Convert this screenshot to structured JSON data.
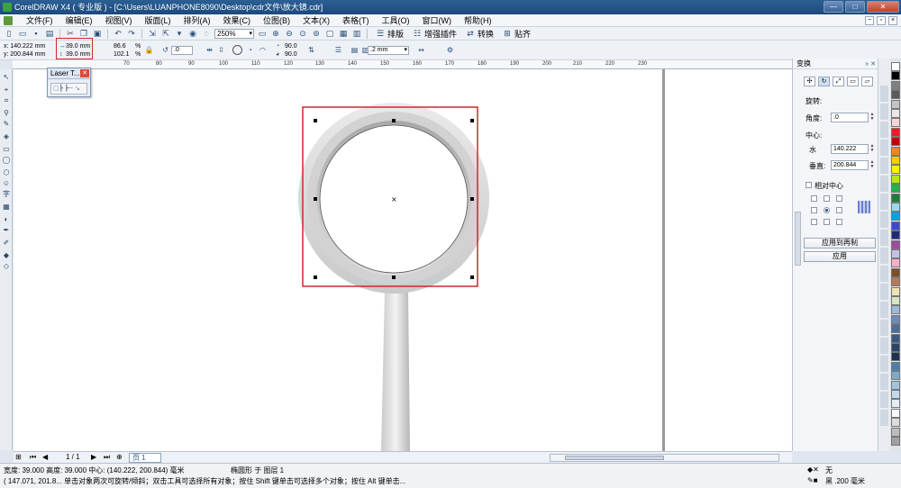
{
  "window": {
    "title": "CorelDRAW X4 ( 专业版 ) - [C:\\Users\\LUANPHONE8090\\Desktop\\cdr文件\\放大镜.cdr]",
    "buttons": [
      "—",
      "□",
      "✕"
    ]
  },
  "menu": [
    "文件(F)",
    "编辑(E)",
    "视图(V)",
    "版面(L)",
    "排列(A)",
    "效果(C)",
    "位图(B)",
    "文本(X)",
    "表格(T)",
    "工具(O)",
    "窗口(W)",
    "帮助(H)"
  ],
  "toolbar": {
    "zoom": "250%",
    "text_buttons": [
      "排版",
      "增强插件",
      "转换",
      "贴齐"
    ]
  },
  "propbar": {
    "x": "x: 140.222 mm",
    "y": "y: 200.844 mm",
    "w": "39.0 mm",
    "h": "39.0 mm",
    "scale_w": "86.6",
    "scale_h": "102.1",
    "pct": "%",
    "rotation": ".0",
    "angle1": "90.0",
    "angle2": "90.0",
    "outline": ".2 mm"
  },
  "ruler": {
    "ticks": [
      "70",
      "80",
      "90",
      "100",
      "110",
      "120",
      "130",
      "140",
      "150",
      "160",
      "170",
      "180",
      "190",
      "200",
      "210",
      "220",
      "230"
    ]
  },
  "laser_window": {
    "title": "Laser T..."
  },
  "docker": {
    "title": "变换",
    "rotate_label": "旋转:",
    "angle_label": "角度:",
    "angle_value": ".0",
    "center_label": "中心:",
    "h_label": "水",
    "h_value": "140.222",
    "v_label": "垂直:",
    "v_value": "200.844",
    "relative_label": "相对中心",
    "apply_dup": "应用到再制",
    "apply": "应用"
  },
  "palette": [
    "#ffffff",
    "#000000",
    "#7f7f7f",
    "#5a5a5a",
    "#c3c3c3",
    "#e8e8e8",
    "#f5d5d5",
    "#ed1c24",
    "#c00000",
    "#ff7f27",
    "#ffc90e",
    "#fff200",
    "#b5e61d",
    "#22b14c",
    "#1e7b3a",
    "#99d9ea",
    "#00a2e8",
    "#3f48cc",
    "#1e2a78",
    "#a349a4",
    "#c8bfe7",
    "#ffaec9",
    "#7f4f21",
    "#b97a57",
    "#efe4b0",
    "#d8e6c8",
    "#9fb8d6",
    "#6d8bb4",
    "#4a6e98",
    "#395a80",
    "#2a4666",
    "#1b3350",
    "#4f7fa7",
    "#82a8c8",
    "#a3c3dc",
    "#c4d8e8",
    "#e3edf4",
    "#f6f9fb",
    "#dcdcdc",
    "#bdbdbd",
    "#a0a0a0"
  ],
  "pagenav": {
    "counter": "1 / 1",
    "page_tab": "页 1"
  },
  "status": {
    "line1": "宽度: 39.000  高度: 39.000  中心: (140.222, 200.844)  毫米",
    "object": "椭圆形 于 图层 1",
    "line2": "( 147.071, 201.8...  单击对象两次可旋转/倾斜；双击工具可选择所有对象；按住 Shift 键单击可选择多个对象；按住 Alt 键单击...",
    "fill_label": "无",
    "outline_label": "黑  .200 毫米"
  }
}
